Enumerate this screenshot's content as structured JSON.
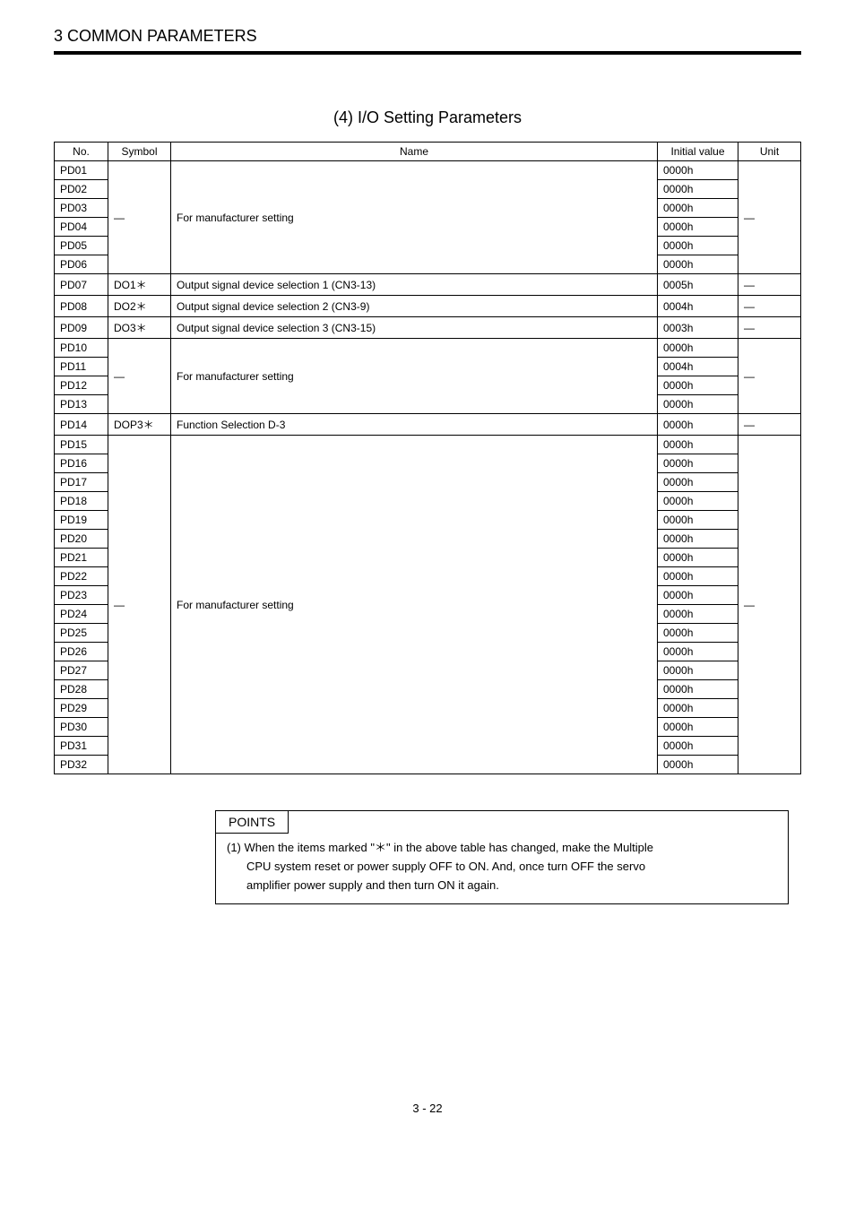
{
  "header": {
    "section": "3   COMMON PARAMETERS"
  },
  "subtitle": "(4)   I/O Setting Parameters",
  "table": {
    "headers": {
      "no": "No.",
      "symbol": "Symbol",
      "name": "Name",
      "initial": "Initial value",
      "unit": "Unit"
    },
    "groups": [
      {
        "symbol": "—",
        "name": "For manufacturer setting",
        "unit": "—",
        "rows": [
          {
            "no": "PD01",
            "init": "0000h"
          },
          {
            "no": "PD02",
            "init": "0000h"
          },
          {
            "no": "PD03",
            "init": "0000h"
          },
          {
            "no": "PD04",
            "init": "0000h"
          },
          {
            "no": "PD05",
            "init": "0000h"
          },
          {
            "no": "PD06",
            "init": "0000h"
          }
        ]
      },
      {
        "single": true,
        "no": "PD07",
        "symbol": "DO1＊",
        "name": "Output signal device selection 1 (CN3-13)",
        "init": "0005h",
        "unit": "—"
      },
      {
        "single": true,
        "no": "PD08",
        "symbol": "DO2＊",
        "name": "Output signal device selection 2 (CN3-9)",
        "init": "0004h",
        "unit": "—"
      },
      {
        "single": true,
        "no": "PD09",
        "symbol": "DO3＊",
        "name": "Output signal device selection 3 (CN3-15)",
        "init": "0003h",
        "unit": "—"
      },
      {
        "symbol": "—",
        "name": "For manufacturer setting",
        "unit": "—",
        "rows": [
          {
            "no": "PD10",
            "init": "0000h"
          },
          {
            "no": "PD11",
            "init": "0004h"
          },
          {
            "no": "PD12",
            "init": "0000h"
          },
          {
            "no": "PD13",
            "init": "0000h"
          }
        ]
      },
      {
        "single": true,
        "no": "PD14",
        "symbol": "DOP3＊",
        "name": "Function Selection D-3",
        "init": "0000h",
        "unit": "—"
      },
      {
        "symbol": "—",
        "name": "For manufacturer setting",
        "unit": "—",
        "rows": [
          {
            "no": "PD15",
            "init": "0000h"
          },
          {
            "no": "PD16",
            "init": "0000h"
          },
          {
            "no": "PD17",
            "init": "0000h"
          },
          {
            "no": "PD18",
            "init": "0000h"
          },
          {
            "no": "PD19",
            "init": "0000h"
          },
          {
            "no": "PD20",
            "init": "0000h"
          },
          {
            "no": "PD21",
            "init": "0000h"
          },
          {
            "no": "PD22",
            "init": "0000h"
          },
          {
            "no": "PD23",
            "init": "0000h"
          },
          {
            "no": "PD24",
            "init": "0000h"
          },
          {
            "no": "PD25",
            "init": "0000h"
          },
          {
            "no": "PD26",
            "init": "0000h"
          },
          {
            "no": "PD27",
            "init": "0000h"
          },
          {
            "no": "PD28",
            "init": "0000h"
          },
          {
            "no": "PD29",
            "init": "0000h"
          },
          {
            "no": "PD30",
            "init": "0000h"
          },
          {
            "no": "PD31",
            "init": "0000h"
          },
          {
            "no": "PD32",
            "init": "0000h"
          }
        ]
      }
    ]
  },
  "points": {
    "label": "POINTS",
    "line1": "(1) When the items marked \"＊\" in the above table has changed, make the Multiple",
    "line2": "CPU system reset or power supply OFF to ON. And, once turn OFF the servo",
    "line3": "amplifier power supply and then turn ON it again."
  },
  "footer": {
    "pagenum": "3 - 22"
  }
}
